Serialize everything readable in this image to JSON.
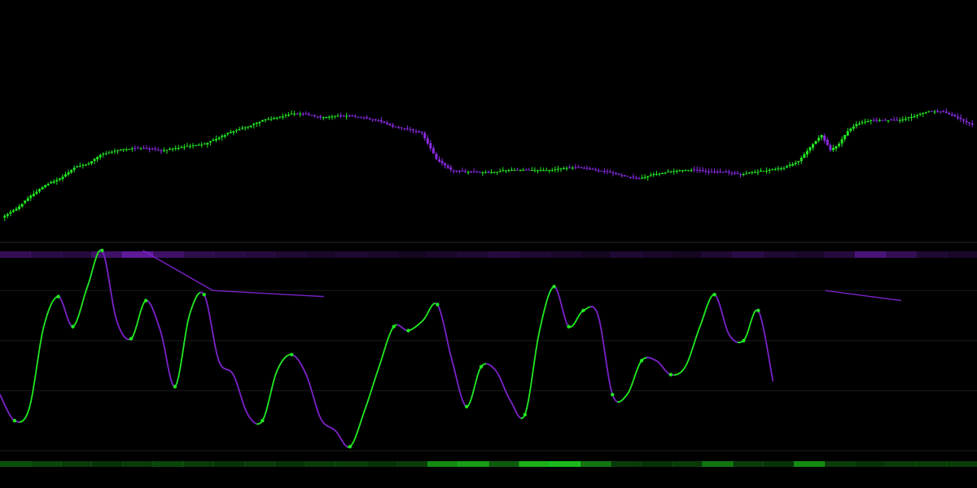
{
  "chart_data": [
    {
      "type": "candlestick",
      "title": "",
      "xlabel": "",
      "ylabel": "",
      "grid": false,
      "legend": "none",
      "ylim": [
        0,
        100
      ],
      "colors": {
        "up": "#22e822",
        "down": "#8a2be2"
      },
      "close_points": [
        [
          0,
          4
        ],
        [
          5,
          8
        ],
        [
          10,
          14
        ],
        [
          15,
          19
        ],
        [
          20,
          22
        ],
        [
          25,
          27
        ],
        [
          30,
          29
        ],
        [
          34,
          33
        ],
        [
          37,
          34
        ],
        [
          40,
          35
        ],
        [
          45,
          36
        ],
        [
          50,
          36
        ],
        [
          55,
          35
        ],
        [
          60,
          36
        ],
        [
          65,
          37
        ],
        [
          70,
          38
        ],
        [
          75,
          41
        ],
        [
          80,
          44
        ],
        [
          85,
          46
        ],
        [
          90,
          49
        ],
        [
          95,
          50
        ],
        [
          100,
          52
        ],
        [
          105,
          52
        ],
        [
          110,
          50
        ],
        [
          115,
          51
        ],
        [
          120,
          51
        ],
        [
          125,
          50
        ],
        [
          130,
          49
        ],
        [
          135,
          46
        ],
        [
          140,
          45
        ],
        [
          145,
          43
        ],
        [
          150,
          31
        ],
        [
          155,
          26
        ],
        [
          160,
          25
        ],
        [
          165,
          25
        ],
        [
          170,
          25
        ],
        [
          175,
          26
        ],
        [
          180,
          26
        ],
        [
          185,
          26
        ],
        [
          190,
          26
        ],
        [
          195,
          27
        ],
        [
          200,
          27
        ],
        [
          205,
          26
        ],
        [
          210,
          25
        ],
        [
          215,
          23
        ],
        [
          220,
          22
        ],
        [
          225,
          24
        ],
        [
          230,
          25
        ],
        [
          235,
          26
        ],
        [
          240,
          26
        ],
        [
          245,
          25
        ],
        [
          250,
          25
        ],
        [
          255,
          24
        ],
        [
          260,
          25
        ],
        [
          265,
          26
        ],
        [
          270,
          27
        ],
        [
          275,
          30
        ],
        [
          280,
          38
        ],
        [
          283,
          42
        ],
        [
          286,
          35
        ],
        [
          289,
          38
        ],
        [
          292,
          44
        ],
        [
          295,
          47
        ],
        [
          300,
          49
        ],
        [
          305,
          49
        ],
        [
          310,
          49
        ],
        [
          315,
          51
        ],
        [
          320,
          53
        ],
        [
          325,
          53
        ],
        [
          330,
          50
        ],
        [
          335,
          47
        ]
      ]
    },
    {
      "type": "line",
      "title": "",
      "xlabel": "",
      "ylabel": "",
      "grid": true,
      "legend": "none",
      "ylim": [
        -4,
        100
      ],
      "x": [
        0,
        5,
        10,
        15,
        20,
        25,
        30,
        35,
        40,
        45,
        50,
        55,
        60,
        65,
        70,
        75,
        80,
        85,
        90,
        95,
        100,
        105,
        110,
        115,
        120,
        125,
        130,
        135,
        140,
        145,
        150,
        155,
        160,
        165,
        170,
        175,
        180,
        185,
        190,
        195,
        200,
        205,
        210,
        215,
        220,
        225,
        230,
        235,
        240,
        245,
        250,
        255,
        260,
        265,
        270,
        275,
        280,
        285,
        290,
        295,
        300,
        305,
        310,
        315,
        320,
        325,
        330,
        335
      ],
      "series": [
        {
          "values": [
            28,
            15,
            21,
            62,
            77,
            62,
            82,
            100,
            65,
            56,
            75,
            60,
            32,
            68,
            78,
            45,
            38,
            18,
            15,
            40,
            48,
            38,
            16,
            10,
            2,
            20,
            42,
            62,
            60,
            65,
            73,
            45,
            22,
            42,
            40,
            25,
            18,
            60,
            82,
            62,
            70,
            68,
            28,
            28,
            45,
            45,
            38,
            42,
            62,
            78,
            58,
            55,
            70,
            35
          ]
        }
      ],
      "colors": {
        "rising": "#22e822",
        "falling": "#7b22c8"
      },
      "reference_levels": [
        80,
        55,
        30,
        0
      ],
      "trendlines": [
        {
          "from": [
            49,
            100
          ],
          "to": [
            73,
            80
          ]
        },
        {
          "from": [
            73,
            80
          ],
          "to": [
            111,
            77
          ]
        },
        {
          "from": [
            283,
            80
          ],
          "to": [
            309,
            75
          ]
        }
      ]
    }
  ],
  "heatstrips": {
    "top_color": "#7b22c8",
    "bottom_color": "#22e822",
    "top_intensity": [
      0.5,
      0.4,
      0.35,
      0.6,
      0.9,
      0.6,
      0.45,
      0.4,
      0.35,
      0.3,
      0.25,
      0.3,
      0.25,
      0.2,
      0.25,
      0.3,
      0.35,
      0.3,
      0.25,
      0.2,
      0.3,
      0.25,
      0.2,
      0.3,
      0.4,
      0.3,
      0.25,
      0.35,
      0.7,
      0.5,
      0.3,
      0.25
    ],
    "bottom_intensity": [
      0.4,
      0.35,
      0.3,
      0.25,
      0.3,
      0.35,
      0.3,
      0.25,
      0.3,
      0.25,
      0.3,
      0.3,
      0.25,
      0.3,
      0.7,
      0.8,
      0.45,
      0.9,
      0.95,
      0.6,
      0.3,
      0.25,
      0.3,
      0.6,
      0.3,
      0.25,
      0.7,
      0.3,
      0.25,
      0.3,
      0.3,
      0.3
    ]
  }
}
